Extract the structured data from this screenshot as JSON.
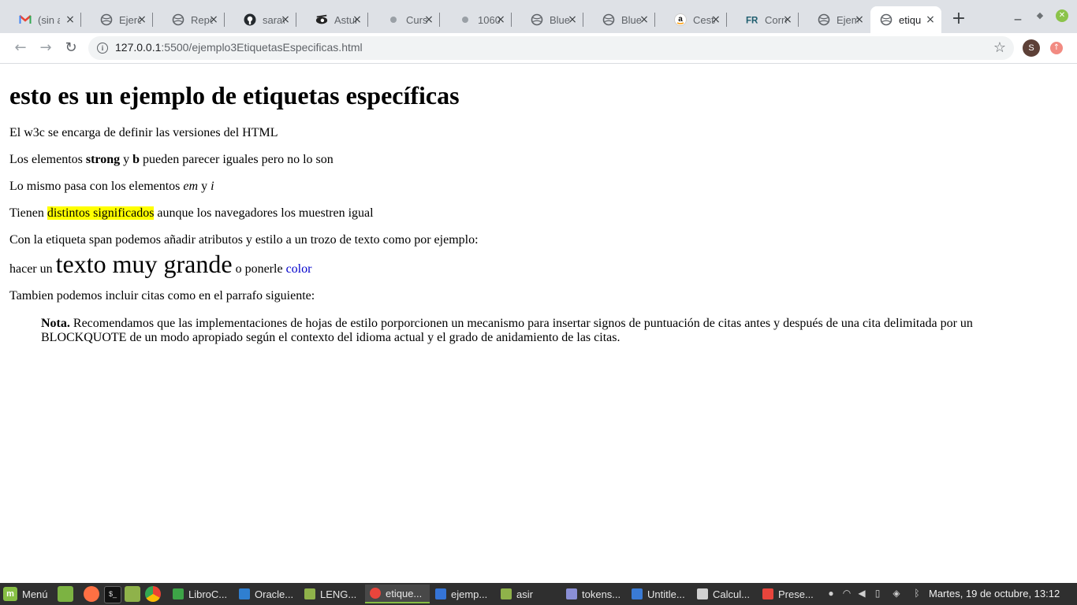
{
  "browser": {
    "tabs": [
      {
        "title": "(sin asunto)",
        "icon": "gmail-icon"
      },
      {
        "title": "Ejercicios",
        "icon": "globe-icon"
      },
      {
        "title": "Repositorio",
        "icon": "globe-icon"
      },
      {
        "title": "saraw",
        "icon": "github-icon"
      },
      {
        "title": "Asturias",
        "icon": "astu-icon"
      },
      {
        "title": "Cursos",
        "icon": "loading-icon"
      },
      {
        "title": "1060",
        "icon": "loading-icon"
      },
      {
        "title": "Blue",
        "icon": "globe-icon"
      },
      {
        "title": "Blue",
        "icon": "globe-icon"
      },
      {
        "title": "Cesta",
        "icon": "amazon-icon"
      },
      {
        "title": "Correo",
        "icon": "fr-icon"
      },
      {
        "title": "Ejemplo",
        "icon": "globe-icon"
      },
      {
        "title": "etiquetas",
        "icon": "globe-icon",
        "active": true
      }
    ],
    "close_glyph": "×",
    "new_tab_glyph": "+",
    "url_host": "127.0.0.1",
    "url_path": ":5500/ejemplo3EtiquetasEspecificas.html",
    "profile_initial": "S"
  },
  "page": {
    "title": "esto es un ejemplo de etiquetas específicas",
    "p1": "El w3c se encarga de definir las versiones del HTML",
    "p2": {
      "a": "Los elementos ",
      "strong": "strong",
      "b_mid": " y ",
      "b": "b",
      "end": " pueden parecer iguales pero no lo son"
    },
    "p3": {
      "a": "Lo mismo pasa con los elementos ",
      "em": "em",
      "mid": " y ",
      "i": "i"
    },
    "p4": {
      "a": "Tienen ",
      "mark": "distintos significados",
      "end": " aunque los navegadores los muestren igual"
    },
    "p5": "Con la etiqueta span podemos añadir atributos y estilo a un trozo de texto como por ejemplo:",
    "p6": {
      "a": "hacer un ",
      "big": "texto muy grande",
      "mid": " o ponerle ",
      "color_text": "color"
    },
    "p7": "Tambien podemos incluir citas como en el parrafo siguiente:",
    "quote": {
      "bold": "Nota.",
      "text": " Recomendamos que las implementaciones de hojas de estilo porporcionen un mecanismo para insertar signos de puntuación de citas antes y después de una cita delimitada por un BLOCKQUOTE de un modo apropiado según el contexto del idioma actual y el grado de anidamiento de las citas."
    }
  },
  "taskbar": {
    "menu_label": "Menú",
    "tasks": [
      {
        "label": "LibroC...",
        "color": "#3da447"
      },
      {
        "label": "Oracle...",
        "color": "#2f7fd0"
      },
      {
        "label": "LENG...",
        "color": "#8fb24a"
      },
      {
        "label": "etique...",
        "color": "#e8453c",
        "active": true
      },
      {
        "label": "ejemp...",
        "color": "#3574d6"
      },
      {
        "label": "asir",
        "color": "#8fb24a"
      },
      {
        "label": "tokens...",
        "color": "#8a8fd6"
      },
      {
        "label": "Untitle...",
        "color": "#3a7bd5"
      },
      {
        "label": "Calcul...",
        "color": "#d0d0d0"
      },
      {
        "label": "Prese...",
        "color": "#e8453c"
      }
    ],
    "clock": "Martes, 19 de octubre, 13:12"
  },
  "colors": {
    "highlight": "#ffff00",
    "link_color": "#0000cc",
    "mint_green": "#86be43"
  }
}
